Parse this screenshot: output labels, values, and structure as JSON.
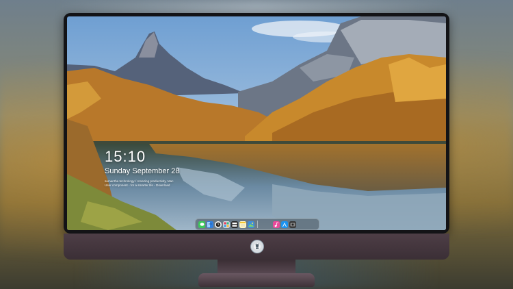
{
  "lock_screen": {
    "time": "15:10",
    "date": "Sunday September 28",
    "notice_line1": "samantha technology / Amazing productivity, Mac",
    "notice_line2": "User component - for a smarter life - Download"
  },
  "dock": {
    "icons": [
      "messages-icon",
      "finder-icon",
      "clock-icon",
      "launchpad-icon",
      "stickies-icon",
      "notes-icon",
      "photos-icon",
      "itunes-icon",
      "app-store-icon",
      "camera-icon"
    ]
  },
  "colors": {
    "sky": "#7fa8d6",
    "foliage": "#c98a2a",
    "bezel": "#131316",
    "chin": "#4e3e46"
  }
}
